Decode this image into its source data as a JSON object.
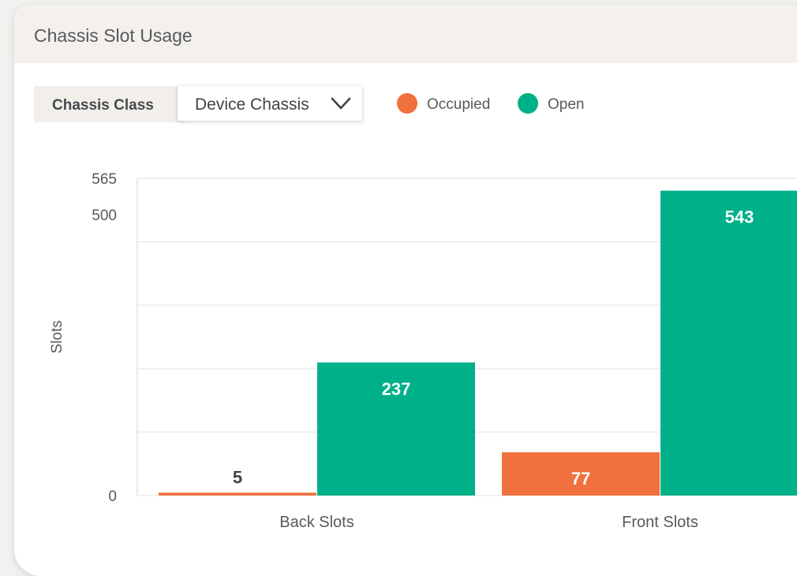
{
  "card": {
    "title": "Chassis Slot Usage"
  },
  "filter": {
    "label": "Chassis Class",
    "selected": "Device Chassis"
  },
  "colors": {
    "occupied": "#f0703e",
    "open": "#00b088",
    "grid": "#e6e2de",
    "axis_text": "#555a5e",
    "bar_label_light": "#ffffff",
    "bar_label_dark": "#3f4346"
  },
  "icons": {
    "dropdown": "chevron-down-icon"
  },
  "chart_data": {
    "type": "bar",
    "categories": [
      "Back Slots",
      "Front Slots"
    ],
    "series": [
      {
        "name": "Occupied",
        "values": [
          5,
          77
        ]
      },
      {
        "name": "Open",
        "values": [
          237,
          543
        ]
      }
    ],
    "ylabel": "Slots",
    "ylim": [
      0,
      565
    ],
    "yticks": [
      0,
      500,
      565
    ],
    "grid": true,
    "legend": "top-left"
  }
}
